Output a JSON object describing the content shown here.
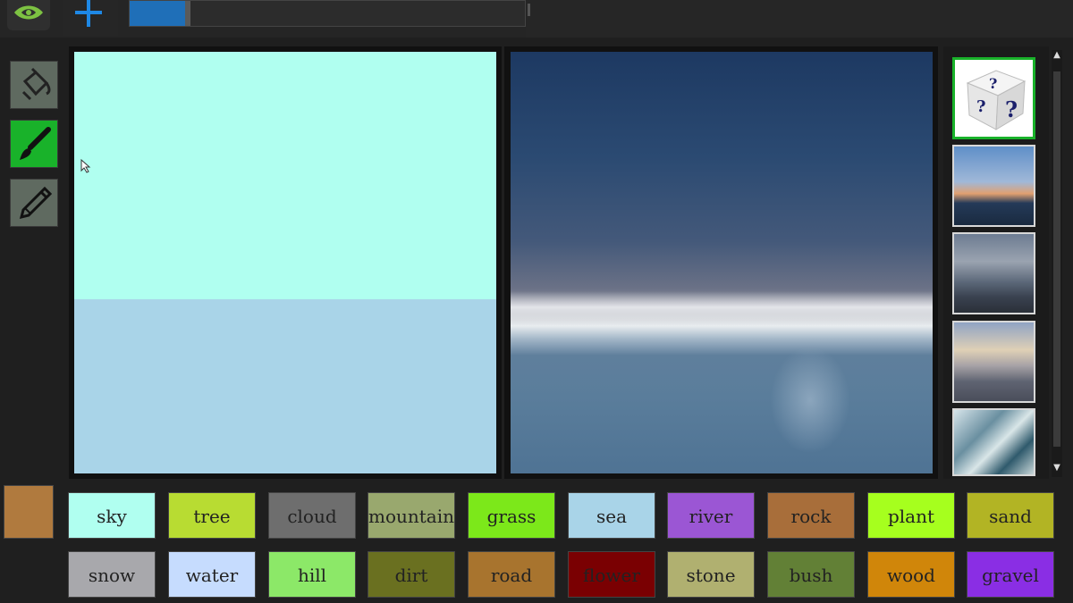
{
  "toolbar": {
    "logo_icon": "nvidia-eye-icon",
    "add_icon": "plus-icon",
    "progress": {
      "value_percent": 14,
      "fill_color": "#1f6fb8"
    }
  },
  "tools": [
    {
      "name": "paint-bucket",
      "icon": "paint-bucket-icon",
      "active": false
    },
    {
      "name": "brush",
      "icon": "brush-icon",
      "active": true
    },
    {
      "name": "pencil",
      "icon": "pencil-icon",
      "active": false
    }
  ],
  "canvas": {
    "regions": [
      {
        "label": "sky",
        "color": "#b0fff0"
      },
      {
        "label": "sea",
        "color": "#a9d4e8"
      }
    ]
  },
  "thumbnails": [
    {
      "icon": "random-dice-icon",
      "active": true
    },
    {
      "icon": "sunset-style-thumbnail",
      "active": false
    },
    {
      "icon": "cloudy-style-thumbnail",
      "active": false
    },
    {
      "icon": "dusk-style-thumbnail",
      "active": false
    },
    {
      "icon": "wave-style-thumbnail",
      "active": false
    }
  ],
  "current_color": "#b07a3e",
  "labels": [
    {
      "text": "sky",
      "color": "#b0fff0"
    },
    {
      "text": "tree",
      "color": "#b8dc32"
    },
    {
      "text": "cloud",
      "color": "#6e6e6e"
    },
    {
      "text": "mountain",
      "color": "#99a86e"
    },
    {
      "text": "grass",
      "color": "#7ce81a"
    },
    {
      "text": "sea",
      "color": "#a9d4e8"
    },
    {
      "text": "river",
      "color": "#9b56d4"
    },
    {
      "text": "rock",
      "color": "#a86e3a"
    },
    {
      "text": "plant",
      "color": "#a6ff1e"
    },
    {
      "text": "sand",
      "color": "#b2b424"
    },
    {
      "text": "snow",
      "color": "#a8a8ac"
    },
    {
      "text": "water",
      "color": "#c6dcfe"
    },
    {
      "text": "hill",
      "color": "#8ce868"
    },
    {
      "text": "dirt",
      "color": "#6a7020"
    },
    {
      "text": "road",
      "color": "#a8742e"
    },
    {
      "text": "flower",
      "color": "#7a0002"
    },
    {
      "text": "stone",
      "color": "#b0b070"
    },
    {
      "text": "bush",
      "color": "#628036"
    },
    {
      "text": "wood",
      "color": "#d0860a"
    },
    {
      "text": "gravel",
      "color": "#8a2ee4"
    }
  ]
}
